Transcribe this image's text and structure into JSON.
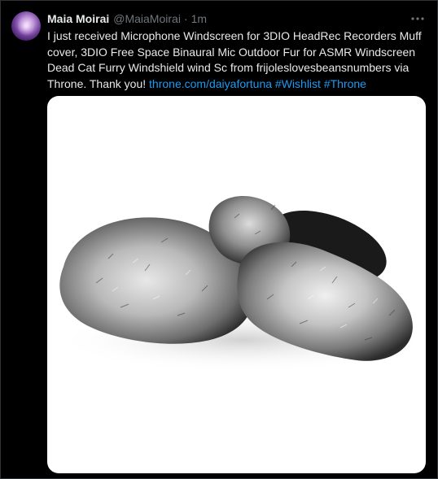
{
  "tweet": {
    "author_name": "Maia Moirai",
    "author_handle": "@MaiaMoirai",
    "separator": "·",
    "time": "1m",
    "text_plain": "I just received Microphone Windscreen for 3DIO HeadRec Recorders Muff cover, 3DIO Free Space Binaural Mic Outdoor Fur for ASMR Windscreen Dead Cat Furry Windshield wind Sc from frijoleslovesbeansnumbers via Throne. Thank you! ",
    "link_url": "throne.com/daiyafortuna",
    "hashtag_1": "#Wishlist",
    "hashtag_2": "#Throne"
  },
  "icons": {
    "more": "more-horizontal-icon"
  },
  "colors": {
    "background": "#000000",
    "text_primary": "#e7e9ea",
    "text_secondary": "#71767b",
    "link": "#1d9bf0",
    "border": "#2f3336"
  }
}
